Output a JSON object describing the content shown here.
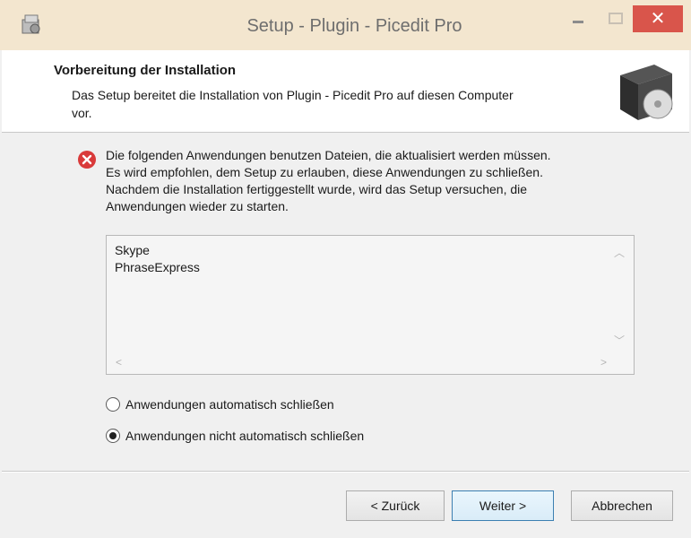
{
  "window": {
    "title": "Setup - Plugin - Picedit Pro",
    "close_glyph": "✕"
  },
  "header": {
    "title": "Vorbereitung der Installation",
    "subtitle_line1": "Das Setup bereitet die Installation von Plugin - Picedit Pro auf diesen Computer",
    "subtitle_line2": "vor."
  },
  "message": {
    "icon": "error-icon",
    "lines": [
      "Die folgenden Anwendungen benutzen Dateien, die aktualisiert werden müssen.",
      "Es wird empfohlen, dem Setup zu erlauben, diese Anwendungen zu schließen.",
      "Nachdem die Installation fertiggestellt wurde, wird das Setup versuchen, die",
      "Anwendungen wieder zu starten."
    ]
  },
  "apps_list": {
    "items": [
      "Skype",
      "PhraseExpress"
    ]
  },
  "options": {
    "auto_close": {
      "label": "Anwendungen automatisch schließen",
      "checked": false
    },
    "no_auto_close": {
      "label": "Anwendungen nicht automatisch schließen",
      "checked": true
    }
  },
  "buttons": {
    "back": "< Zurück",
    "next": "Weiter >",
    "cancel": "Abbrechen"
  },
  "colors": {
    "titlebar": "#f3e6cf",
    "close_button": "#d9554b",
    "error_icon": "#d93a3a"
  }
}
